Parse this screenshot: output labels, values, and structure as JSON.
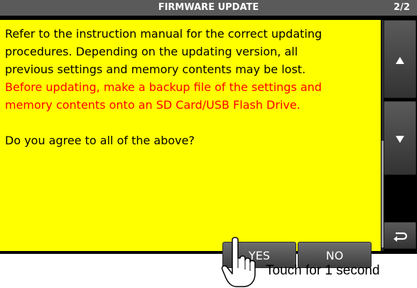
{
  "header": {
    "title": "FIRMWARE UPDATE",
    "page_indicator": "2/2"
  },
  "message": {
    "line1": "Refer to the instruction manual for the correct updating",
    "line2": "procedures. Depending on the updating version, all",
    "line3": "previous settings and memory contents may be lost.",
    "warning1": "Before updating, make a backup file of the settings and",
    "warning2": "memory contents onto an SD Card/USB Flash Drive.",
    "question": "Do you agree to all of the above?"
  },
  "buttons": {
    "yes": "YES",
    "no": "NO"
  },
  "side_controls": {
    "up_icon": "triangle-up-icon",
    "down_icon": "triangle-down-icon",
    "back_icon": "return-arrow-icon"
  },
  "annotation": {
    "instruction": "Touch for 1 second"
  },
  "colors": {
    "message_background": "#ffff00",
    "warning_text": "#ff0000",
    "titlebar": "#5a5a5a"
  }
}
